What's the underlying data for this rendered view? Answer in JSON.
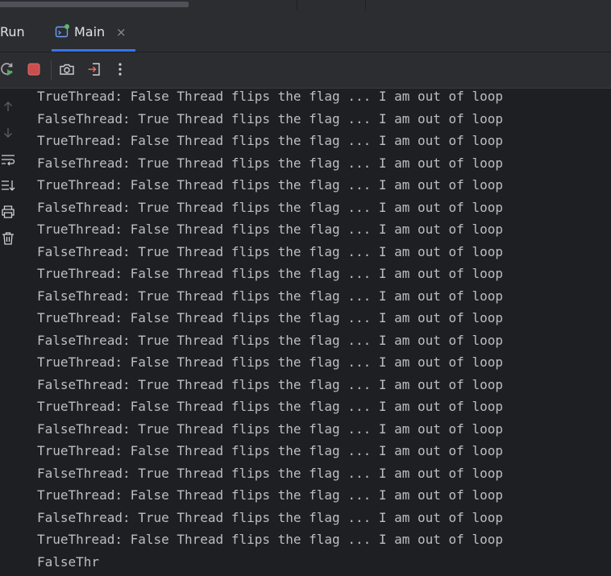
{
  "tool_window": {
    "title": "Run",
    "tab": {
      "label": "Main",
      "close": "×",
      "icon": "run-config-icon"
    }
  },
  "toolbar": {
    "buttons": [
      {
        "name": "rerun-icon",
        "color": "#59a869"
      },
      {
        "name": "stop-icon",
        "color": "#c94f4f"
      },
      {
        "name": "camera-icon"
      },
      {
        "name": "exit-icon"
      },
      {
        "name": "more-options-icon"
      }
    ]
  },
  "gutter": {
    "icons": [
      "up-arrow-icon",
      "down-arrow-icon",
      "soft-wrap-icon",
      "scroll-to-end-icon",
      "print-icon",
      "trash-icon"
    ]
  },
  "console": {
    "lines": [
      "TrueThread: False Thread flips the flag ... I am out of loop",
      "FalseThread: True Thread flips the flag ... I am out of loop",
      "TrueThread: False Thread flips the flag ... I am out of loop",
      "FalseThread: True Thread flips the flag ... I am out of loop",
      "TrueThread: False Thread flips the flag ... I am out of loop",
      "FalseThread: True Thread flips the flag ... I am out of loop",
      "TrueThread: False Thread flips the flag ... I am out of loop",
      "FalseThread: True Thread flips the flag ... I am out of loop",
      "TrueThread: False Thread flips the flag ... I am out of loop",
      "FalseThread: True Thread flips the flag ... I am out of loop",
      "TrueThread: False Thread flips the flag ... I am out of loop",
      "FalseThread: True Thread flips the flag ... I am out of loop",
      "TrueThread: False Thread flips the flag ... I am out of loop",
      "FalseThread: True Thread flips the flag ... I am out of loop",
      "TrueThread: False Thread flips the flag ... I am out of loop",
      "FalseThread: True Thread flips the flag ... I am out of loop",
      "TrueThread: False Thread flips the flag ... I am out of loop",
      "FalseThread: True Thread flips the flag ... I am out of loop",
      "TrueThread: False Thread flips the flag ... I am out of loop",
      "FalseThread: True Thread flips the flag ... I am out of loop",
      "TrueThread: False Thread flips the flag ... I am out of loop",
      "FalseThr"
    ]
  },
  "colors": {
    "background": "#1e1f22",
    "panel": "#2b2d30",
    "text": "#bcbec4",
    "accent": "#3574f0"
  }
}
